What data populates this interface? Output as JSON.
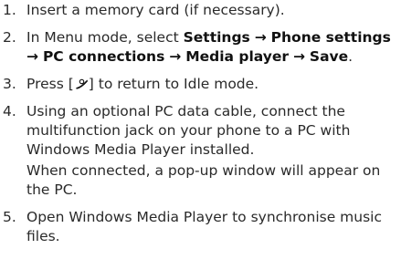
{
  "steps": [
    {
      "number": "1.",
      "text": "Insert a memory card (if necessary)."
    },
    {
      "number": "2.",
      "prefix": "In Menu mode, select ",
      "path": [
        "Settings",
        "Phone settings",
        "PC connections",
        "Media player",
        "Save"
      ],
      "arrow": "→",
      "suffix": "."
    },
    {
      "number": "3.",
      "before": "Press [",
      "key_icon": "end-call-key-icon",
      "after": "] to return to Idle mode."
    },
    {
      "number": "4.",
      "text": "Using an optional PC data cable, connect the multifunction jack on your phone to a PC with Windows Media Player installed.",
      "note": "When connected, a pop-up window will appear on the PC."
    },
    {
      "number": "5.",
      "text": "Open Windows Media Player to synchronise music files."
    }
  ]
}
